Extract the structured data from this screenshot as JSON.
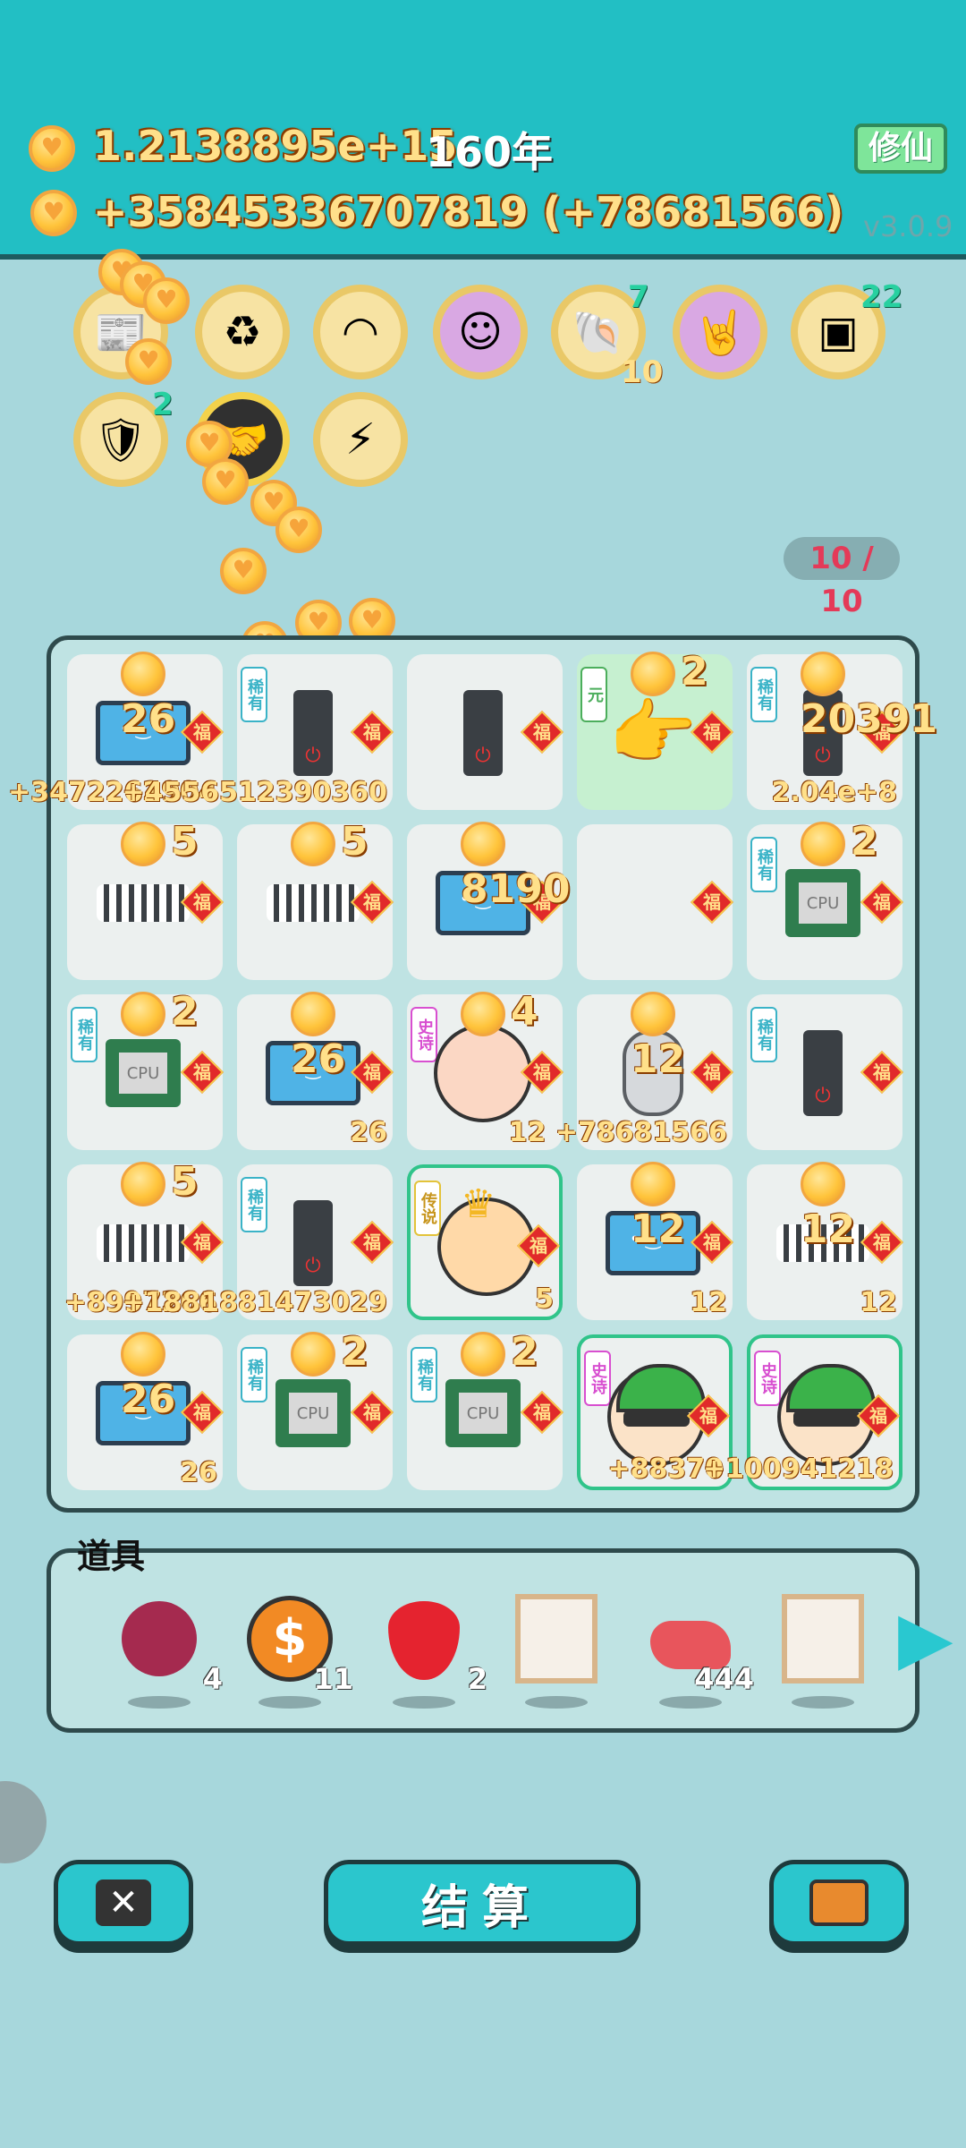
{
  "header": {
    "coins_total": "1.2138895e+15",
    "year": "160年",
    "coins_rate": "+35845336707819 (+78681566)",
    "cultivate_label": "修仙",
    "version": "v3.0.9"
  },
  "buffs": [
    {
      "icon": "time-magazine-icon",
      "count": ""
    },
    {
      "icon": "recycle-icon",
      "count": ""
    },
    {
      "icon": "skirt-icon",
      "count": ""
    },
    {
      "icon": "hacker-face-icon",
      "count": ""
    },
    {
      "icon": "shell-icon",
      "count": "7",
      "sub": "10"
    },
    {
      "icon": "rock-hand-icon",
      "count": ""
    },
    {
      "icon": "chip-icon",
      "count": "22"
    },
    {
      "icon": "shield-wrench-icon",
      "count": "2"
    },
    {
      "icon": "handshake-icon",
      "count": ""
    },
    {
      "icon": "lightning-icon",
      "count": ""
    }
  ],
  "slots": "10 / 10",
  "board": {
    "rows": [
      [
        {
          "item": "monitor",
          "count": "26",
          "rarity": "",
          "bottom": "+3472262904"
        },
        {
          "item": "tower",
          "count": "",
          "rarity": "稀有",
          "bottom": "+4556512390360"
        },
        {
          "item": "tower",
          "count": "",
          "rarity": "",
          "bottom": ""
        },
        {
          "item": "pointer-hand",
          "count": "2",
          "rarity": "元",
          "bottom": ""
        },
        {
          "item": "tower",
          "count": "20391",
          "rarity": "稀有",
          "bottom": "2.04e+8"
        }
      ],
      [
        {
          "item": "keyboard",
          "count": "5",
          "rarity": "",
          "bottom": ""
        },
        {
          "item": "keyboard",
          "count": "5",
          "rarity": "",
          "bottom": ""
        },
        {
          "item": "monitor",
          "count": "8190",
          "rarity": "",
          "bottom": ""
        },
        {
          "item": "empty",
          "count": "",
          "rarity": "",
          "bottom": ""
        },
        {
          "item": "cpu",
          "count": "2",
          "rarity": "稀有",
          "bottom": ""
        }
      ],
      [
        {
          "item": "cpu",
          "count": "2",
          "rarity": "稀有",
          "bottom": ""
        },
        {
          "item": "monitor",
          "count": "26",
          "rarity": "",
          "bottom": "26"
        },
        {
          "item": "girl",
          "count": "4",
          "rarity": "史诗",
          "bottom": ""
        },
        {
          "item": "mouse",
          "count": "12",
          "rarity": "",
          "bottom": "12 +78681566"
        },
        {
          "item": "tower",
          "count": "",
          "rarity": "稀有",
          "bottom": ""
        }
      ],
      [
        {
          "item": "keyboard",
          "count": "5",
          "rarity": "",
          "bottom": "+8997266"
        },
        {
          "item": "tower",
          "count": "",
          "rarity": "稀有",
          "bottom": "+1881881473029"
        },
        {
          "item": "king",
          "count": "",
          "rarity": "传说",
          "bottom": "5"
        },
        {
          "item": "monitor",
          "count": "12",
          "rarity": "",
          "bottom": "12"
        },
        {
          "item": "keyboard",
          "count": "12",
          "rarity": "",
          "bottom": "12"
        }
      ],
      [
        {
          "item": "monitor",
          "count": "26",
          "rarity": "",
          "bottom": "26"
        },
        {
          "item": "cpu",
          "count": "2",
          "rarity": "稀有",
          "bottom": ""
        },
        {
          "item": "cpu",
          "count": "2",
          "rarity": "稀有",
          "bottom": ""
        },
        {
          "item": "hacker",
          "count": "",
          "rarity": "史诗",
          "bottom": "+88370"
        },
        {
          "item": "hacker",
          "count": "",
          "rarity": "史诗",
          "bottom": "+100941218"
        }
      ]
    ]
  },
  "fu_label": "福",
  "tools": {
    "label": "道具",
    "items": [
      {
        "icon": "lychee-icon",
        "qty": "4"
      },
      {
        "icon": "dollar-coin-icon",
        "qty": "11"
      },
      {
        "icon": "strawberry-icon",
        "qty": "2"
      },
      {
        "icon": "frame-icon",
        "qty": ""
      },
      {
        "icon": "liver-icon",
        "qty": "444"
      },
      {
        "icon": "frame-icon",
        "qty": ""
      }
    ]
  },
  "buttons": {
    "settle": "结算",
    "close_glyph": "✕"
  }
}
